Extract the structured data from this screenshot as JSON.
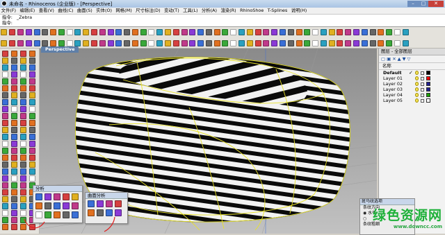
{
  "window": {
    "title": "未命名 - Rhinoceros (企业版) - [Perspective]"
  },
  "menu": [
    "文件(F)",
    "编辑(E)",
    "查看(V)",
    "曲线(C)",
    "曲面(S)",
    "实体(O)",
    "网格(M)",
    "尺寸标注(D)",
    "变动(T)",
    "工具(L)",
    "分析(A)",
    "渲染(R)",
    "RhinoShoe",
    "T-Splines",
    "说明(H)"
  ],
  "command": {
    "history_label": "指令:",
    "history_value": "_Zebra",
    "prompt": "指令:"
  },
  "viewport": {
    "label": "Perspective"
  },
  "layers": {
    "panel_title": "图层 - 全部图层",
    "column_name": "名称",
    "items": [
      {
        "name": "Default",
        "current": true,
        "color": "#000000"
      },
      {
        "name": "Layer 01",
        "current": false,
        "color": "#ff0000"
      },
      {
        "name": "Layer 02",
        "current": false,
        "color": "#1f1f8f"
      },
      {
        "name": "Layer 03",
        "current": false,
        "color": "#1f1f8f"
      },
      {
        "name": "Layer 04",
        "current": false,
        "color": "#1aa000"
      },
      {
        "name": "Layer 05",
        "current": false,
        "color": "#ffffff"
      }
    ]
  },
  "analysis_toolbar": {
    "title": "分析"
  },
  "surface_analysis_toolbar": {
    "title": "曲面分析"
  },
  "zebra_panel": {
    "title": "斑马纹选项",
    "direction_label": "条纹方向",
    "direction_value": "水平",
    "thickness_label": "条纹粗细"
  },
  "watermark": {
    "line1": "绿色资源网",
    "line2": "www.downcc.com"
  }
}
